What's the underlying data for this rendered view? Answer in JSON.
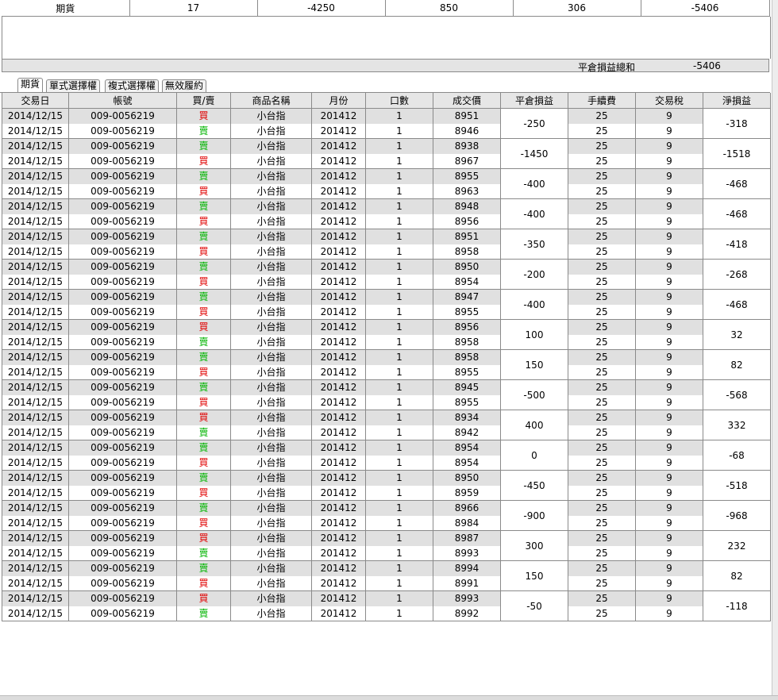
{
  "summary": {
    "cells": [
      "期貨",
      "17",
      "-4250",
      "850",
      "306",
      "-5406"
    ],
    "total_label": "平倉損益總和",
    "total_value": "-5406"
  },
  "tabs": [
    "期貨",
    "單式選擇權",
    "複式選擇權",
    "無效履約"
  ],
  "columns": [
    "交易日",
    "帳號",
    "買/賣",
    "商品名稱",
    "月份",
    "口數",
    "成交價",
    "平倉損益",
    "手續費",
    "交易稅",
    "淨損益"
  ],
  "colors": {
    "buy": "#e00000",
    "sell": "#00b400"
  },
  "trades": [
    {
      "pnl": "-250",
      "net": "-318",
      "legs": [
        {
          "date": "2014/12/15",
          "account": "009-0056219",
          "side": "買",
          "product": "小台指",
          "month": "201412",
          "qty": "1",
          "price": "8951",
          "fee": "25",
          "tax": "9"
        },
        {
          "date": "2014/12/15",
          "account": "009-0056219",
          "side": "賣",
          "product": "小台指",
          "month": "201412",
          "qty": "1",
          "price": "8946",
          "fee": "25",
          "tax": "9"
        }
      ]
    },
    {
      "pnl": "-1450",
      "net": "-1518",
      "legs": [
        {
          "date": "2014/12/15",
          "account": "009-0056219",
          "side": "賣",
          "product": "小台指",
          "month": "201412",
          "qty": "1",
          "price": "8938",
          "fee": "25",
          "tax": "9"
        },
        {
          "date": "2014/12/15",
          "account": "009-0056219",
          "side": "買",
          "product": "小台指",
          "month": "201412",
          "qty": "1",
          "price": "8967",
          "fee": "25",
          "tax": "9"
        }
      ]
    },
    {
      "pnl": "-400",
      "net": "-468",
      "legs": [
        {
          "date": "2014/12/15",
          "account": "009-0056219",
          "side": "賣",
          "product": "小台指",
          "month": "201412",
          "qty": "1",
          "price": "8955",
          "fee": "25",
          "tax": "9"
        },
        {
          "date": "2014/12/15",
          "account": "009-0056219",
          "side": "買",
          "product": "小台指",
          "month": "201412",
          "qty": "1",
          "price": "8963",
          "fee": "25",
          "tax": "9"
        }
      ]
    },
    {
      "pnl": "-400",
      "net": "-468",
      "legs": [
        {
          "date": "2014/12/15",
          "account": "009-0056219",
          "side": "賣",
          "product": "小台指",
          "month": "201412",
          "qty": "1",
          "price": "8948",
          "fee": "25",
          "tax": "9"
        },
        {
          "date": "2014/12/15",
          "account": "009-0056219",
          "side": "買",
          "product": "小台指",
          "month": "201412",
          "qty": "1",
          "price": "8956",
          "fee": "25",
          "tax": "9"
        }
      ]
    },
    {
      "pnl": "-350",
      "net": "-418",
      "legs": [
        {
          "date": "2014/12/15",
          "account": "009-0056219",
          "side": "賣",
          "product": "小台指",
          "month": "201412",
          "qty": "1",
          "price": "8951",
          "fee": "25",
          "tax": "9"
        },
        {
          "date": "2014/12/15",
          "account": "009-0056219",
          "side": "買",
          "product": "小台指",
          "month": "201412",
          "qty": "1",
          "price": "8958",
          "fee": "25",
          "tax": "9"
        }
      ]
    },
    {
      "pnl": "-200",
      "net": "-268",
      "legs": [
        {
          "date": "2014/12/15",
          "account": "009-0056219",
          "side": "賣",
          "product": "小台指",
          "month": "201412",
          "qty": "1",
          "price": "8950",
          "fee": "25",
          "tax": "9"
        },
        {
          "date": "2014/12/15",
          "account": "009-0056219",
          "side": "買",
          "product": "小台指",
          "month": "201412",
          "qty": "1",
          "price": "8954",
          "fee": "25",
          "tax": "9"
        }
      ]
    },
    {
      "pnl": "-400",
      "net": "-468",
      "legs": [
        {
          "date": "2014/12/15",
          "account": "009-0056219",
          "side": "賣",
          "product": "小台指",
          "month": "201412",
          "qty": "1",
          "price": "8947",
          "fee": "25",
          "tax": "9"
        },
        {
          "date": "2014/12/15",
          "account": "009-0056219",
          "side": "買",
          "product": "小台指",
          "month": "201412",
          "qty": "1",
          "price": "8955",
          "fee": "25",
          "tax": "9"
        }
      ]
    },
    {
      "pnl": "100",
      "net": "32",
      "legs": [
        {
          "date": "2014/12/15",
          "account": "009-0056219",
          "side": "買",
          "product": "小台指",
          "month": "201412",
          "qty": "1",
          "price": "8956",
          "fee": "25",
          "tax": "9"
        },
        {
          "date": "2014/12/15",
          "account": "009-0056219",
          "side": "賣",
          "product": "小台指",
          "month": "201412",
          "qty": "1",
          "price": "8958",
          "fee": "25",
          "tax": "9"
        }
      ]
    },
    {
      "pnl": "150",
      "net": "82",
      "legs": [
        {
          "date": "2014/12/15",
          "account": "009-0056219",
          "side": "賣",
          "product": "小台指",
          "month": "201412",
          "qty": "1",
          "price": "8958",
          "fee": "25",
          "tax": "9"
        },
        {
          "date": "2014/12/15",
          "account": "009-0056219",
          "side": "買",
          "product": "小台指",
          "month": "201412",
          "qty": "1",
          "price": "8955",
          "fee": "25",
          "tax": "9"
        }
      ]
    },
    {
      "pnl": "-500",
      "net": "-568",
      "legs": [
        {
          "date": "2014/12/15",
          "account": "009-0056219",
          "side": "賣",
          "product": "小台指",
          "month": "201412",
          "qty": "1",
          "price": "8945",
          "fee": "25",
          "tax": "9"
        },
        {
          "date": "2014/12/15",
          "account": "009-0056219",
          "side": "買",
          "product": "小台指",
          "month": "201412",
          "qty": "1",
          "price": "8955",
          "fee": "25",
          "tax": "9"
        }
      ]
    },
    {
      "pnl": "400",
      "net": "332",
      "legs": [
        {
          "date": "2014/12/15",
          "account": "009-0056219",
          "side": "買",
          "product": "小台指",
          "month": "201412",
          "qty": "1",
          "price": "8934",
          "fee": "25",
          "tax": "9"
        },
        {
          "date": "2014/12/15",
          "account": "009-0056219",
          "side": "賣",
          "product": "小台指",
          "month": "201412",
          "qty": "1",
          "price": "8942",
          "fee": "25",
          "tax": "9"
        }
      ]
    },
    {
      "pnl": "0",
      "net": "-68",
      "legs": [
        {
          "date": "2014/12/15",
          "account": "009-0056219",
          "side": "賣",
          "product": "小台指",
          "month": "201412",
          "qty": "1",
          "price": "8954",
          "fee": "25",
          "tax": "9"
        },
        {
          "date": "2014/12/15",
          "account": "009-0056219",
          "side": "買",
          "product": "小台指",
          "month": "201412",
          "qty": "1",
          "price": "8954",
          "fee": "25",
          "tax": "9"
        }
      ]
    },
    {
      "pnl": "-450",
      "net": "-518",
      "legs": [
        {
          "date": "2014/12/15",
          "account": "009-0056219",
          "side": "賣",
          "product": "小台指",
          "month": "201412",
          "qty": "1",
          "price": "8950",
          "fee": "25",
          "tax": "9"
        },
        {
          "date": "2014/12/15",
          "account": "009-0056219",
          "side": "買",
          "product": "小台指",
          "month": "201412",
          "qty": "1",
          "price": "8959",
          "fee": "25",
          "tax": "9"
        }
      ]
    },
    {
      "pnl": "-900",
      "net": "-968",
      "legs": [
        {
          "date": "2014/12/15",
          "account": "009-0056219",
          "side": "賣",
          "product": "小台指",
          "month": "201412",
          "qty": "1",
          "price": "8966",
          "fee": "25",
          "tax": "9"
        },
        {
          "date": "2014/12/15",
          "account": "009-0056219",
          "side": "買",
          "product": "小台指",
          "month": "201412",
          "qty": "1",
          "price": "8984",
          "fee": "25",
          "tax": "9"
        }
      ]
    },
    {
      "pnl": "300",
      "net": "232",
      "legs": [
        {
          "date": "2014/12/15",
          "account": "009-0056219",
          "side": "買",
          "product": "小台指",
          "month": "201412",
          "qty": "1",
          "price": "8987",
          "fee": "25",
          "tax": "9"
        },
        {
          "date": "2014/12/15",
          "account": "009-0056219",
          "side": "賣",
          "product": "小台指",
          "month": "201412",
          "qty": "1",
          "price": "8993",
          "fee": "25",
          "tax": "9"
        }
      ]
    },
    {
      "pnl": "150",
      "net": "82",
      "legs": [
        {
          "date": "2014/12/15",
          "account": "009-0056219",
          "side": "賣",
          "product": "小台指",
          "month": "201412",
          "qty": "1",
          "price": "8994",
          "fee": "25",
          "tax": "9"
        },
        {
          "date": "2014/12/15",
          "account": "009-0056219",
          "side": "買",
          "product": "小台指",
          "month": "201412",
          "qty": "1",
          "price": "8991",
          "fee": "25",
          "tax": "9"
        }
      ]
    },
    {
      "pnl": "-50",
      "net": "-118",
      "legs": [
        {
          "date": "2014/12/15",
          "account": "009-0056219",
          "side": "買",
          "product": "小台指",
          "month": "201412",
          "qty": "1",
          "price": "8993",
          "fee": "25",
          "tax": "9"
        },
        {
          "date": "2014/12/15",
          "account": "009-0056219",
          "side": "賣",
          "product": "小台指",
          "month": "201412",
          "qty": "1",
          "price": "8992",
          "fee": "25",
          "tax": "9"
        }
      ]
    }
  ]
}
